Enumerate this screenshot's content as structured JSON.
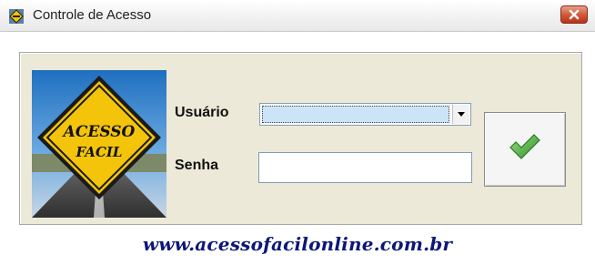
{
  "window": {
    "title": "Controle de Acesso",
    "title_icon": "app-road-sign-icon",
    "close_icon": "close-icon"
  },
  "logo": {
    "alt": "Acesso Fácil logo",
    "line1": "ACESSO",
    "line2": "FACIL"
  },
  "form": {
    "usuario_label": "Usuário",
    "usuario_value": "",
    "senha_label": "Senha",
    "senha_value": ""
  },
  "confirm_button": {
    "icon": "checkmark-icon"
  },
  "footer": {
    "website": "www.acessofacilonline.com.br"
  },
  "colors": {
    "groupbox_bg": "#ece9d8",
    "link": "#0d1778",
    "close": "#c84a2d",
    "check": "#39a83a"
  }
}
